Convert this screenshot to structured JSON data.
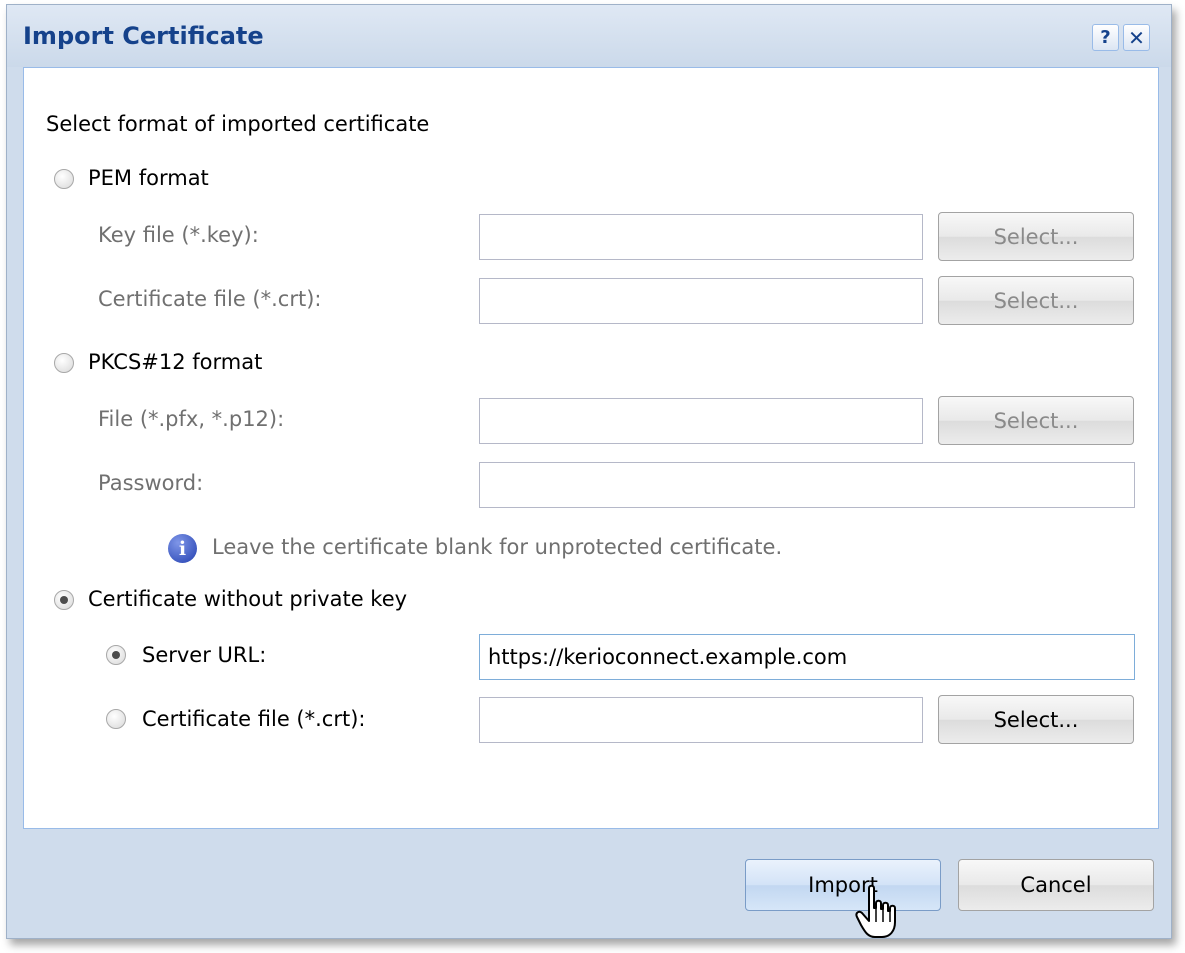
{
  "dialog": {
    "title": "Import Certificate",
    "help_button": "?",
    "close_button": "✕"
  },
  "form": {
    "heading": "Select format of imported certificate",
    "pem": {
      "label": "PEM format",
      "selected": false,
      "key_file_label": "Key file (*.key):",
      "key_file_value": "",
      "cert_file_label": "Certificate file (*.crt):",
      "cert_file_value": "",
      "select_label": "Select..."
    },
    "pkcs12": {
      "label": "PKCS#12 format",
      "selected": false,
      "file_label": "File (*.pfx, *.p12):",
      "file_value": "",
      "password_label": "Password:",
      "password_value": "",
      "select_label": "Select...",
      "info_icon": "info-icon",
      "info_text": "Leave the certificate blank for unprotected certificate."
    },
    "no_private_key": {
      "label": "Certificate without private key",
      "selected": true,
      "server_url_label": "Server URL:",
      "server_url_selected": true,
      "server_url_value": "https://kerioconnect.example.com",
      "cert_file_label": "Certificate file (*.crt):",
      "cert_file_selected": false,
      "cert_file_value": "",
      "select_label": "Select..."
    }
  },
  "footer": {
    "import_label": "Import",
    "cancel_label": "Cancel"
  },
  "colors": {
    "title": "#15428b",
    "frame": "#cfdcec",
    "border": "#99bbe8"
  }
}
